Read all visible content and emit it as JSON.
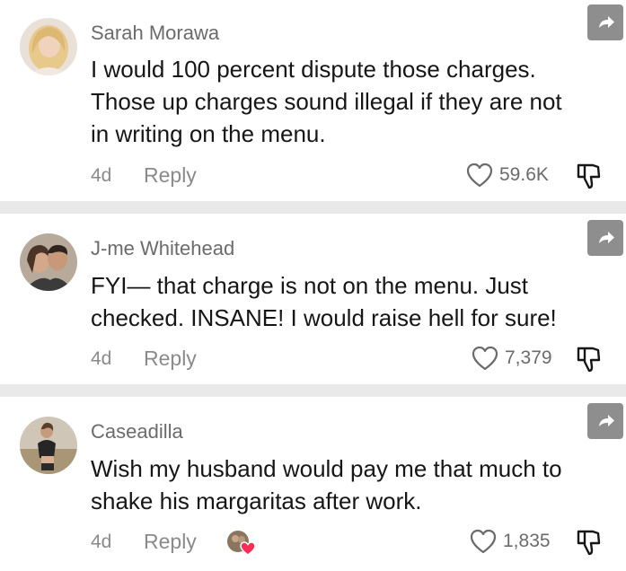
{
  "comments": [
    {
      "username": "Sarah Morawa",
      "lines": [
        "I would 100 percent dispute those charges.",
        "Those up charges sound illegal if they are not",
        "in writing on the menu."
      ],
      "time": "4d",
      "reply_label": "Reply",
      "likes": "59.6K",
      "icons": {
        "avatar": "user-avatar",
        "share": "share-arrow-icon",
        "like": "heart-icon",
        "dislike": "thumbs-down-icon"
      }
    },
    {
      "username": "J-me Whitehead",
      "lines": [
        "FYI— that charge is not on the menu. Just",
        "checked. INSANE! I would raise hell for sure!"
      ],
      "time": "4d",
      "reply_label": "Reply",
      "likes": "7,379",
      "icons": {
        "avatar": "user-avatar",
        "share": "share-arrow-icon",
        "like": "heart-icon",
        "dislike": "thumbs-down-icon"
      }
    },
    {
      "username": "Caseadilla",
      "lines": [
        "Wish my husband would pay me that much to",
        "shake his margaritas after work."
      ],
      "time": "4d",
      "reply_label": "Reply",
      "likes": "1,835",
      "creator_liked": true,
      "icons": {
        "avatar": "user-avatar",
        "share": "share-arrow-icon",
        "like": "heart-icon",
        "dislike": "thumbs-down-icon",
        "creator_liked": "creator-liked-heart-icon"
      }
    }
  ],
  "colors": {
    "background": "#e9e9e9",
    "card": "#ffffff",
    "username": "#6b6b6b",
    "body": "#161616",
    "meta": "#8a8a8a",
    "share_button": "#8e8e8e",
    "creator_heart": "#fe2c55"
  }
}
